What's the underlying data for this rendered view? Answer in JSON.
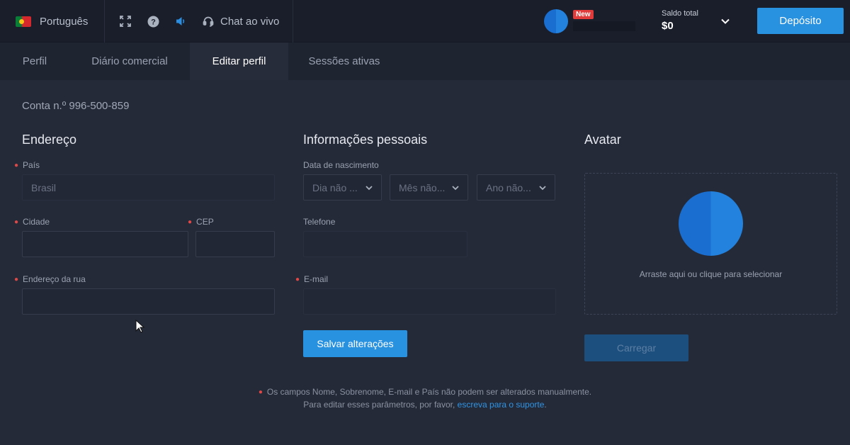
{
  "header": {
    "language": "Português",
    "chat_label": "Chat ao vivo",
    "new_badge": "New",
    "balance_label": "Saldo total",
    "balance_value": "$0",
    "deposit_label": "Depósito"
  },
  "tabs": [
    {
      "label": "Perfil",
      "active": false
    },
    {
      "label": "Diário comercial",
      "active": false
    },
    {
      "label": "Editar perfil",
      "active": true
    },
    {
      "label": "Sessões ativas",
      "active": false
    }
  ],
  "account": "Conta n.º 996-500-859",
  "address": {
    "title": "Endereço",
    "country_label": "País",
    "country_value": "Brasil",
    "city_label": "Cidade",
    "city_value": "",
    "zip_label": "CEP",
    "zip_value": "",
    "street_label": "Endereço da rua",
    "street_value": ""
  },
  "personal": {
    "title": "Informações pessoais",
    "birth_label": "Data de nascimento",
    "day_placeholder": "Dia não ...",
    "month_placeholder": "Mês não...",
    "year_placeholder": "Ano não...",
    "phone_label": "Telefone",
    "phone_value": "",
    "email_label": "E-mail",
    "email_value": "",
    "save_label": "Salvar alterações"
  },
  "avatar": {
    "title": "Avatar",
    "drop_text": "Arraste aqui ou clique para selecionar",
    "upload_label": "Carregar"
  },
  "note": {
    "line1": "Os campos Nome, Sobrenome, E-mail e País não podem ser alterados manualmente.",
    "line2_prefix": "Para editar esses parâmetros, por favor,",
    "link": "escreva para o suporte",
    "line2_suffix": "."
  },
  "colors": {
    "accent": "#2891e0",
    "required": "#e04848",
    "new_badge": "#e23b3b",
    "background": "#252a38"
  }
}
